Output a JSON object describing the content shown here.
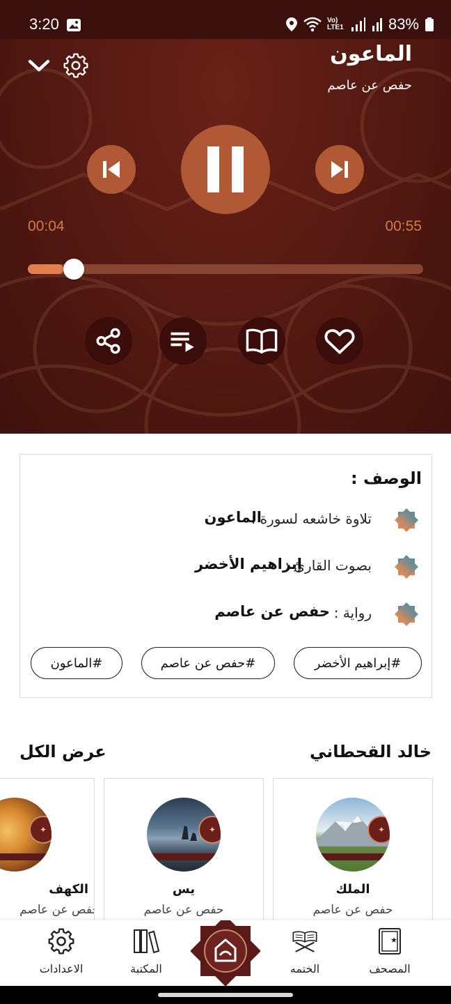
{
  "status": {
    "time": "3:20",
    "battery": "83%",
    "network": "Vo) LTE1"
  },
  "player": {
    "title": "الماعون",
    "subtitle": "حفص عن عاصم",
    "elapsed": "00:04",
    "duration": "00:55",
    "progress": 0.077,
    "is_playing": true,
    "accent_color": "#b15835"
  },
  "description": {
    "heading": "الوصف :",
    "rows": [
      {
        "label": "تلاوة خاشعه لسورة :",
        "value": "الماعون"
      },
      {
        "label": "بصوت القارئ :",
        "value": "إبراهيم الأخضر"
      },
      {
        "label": "رواية :",
        "value": "حفص عن عاصم"
      }
    ],
    "tags": [
      "#إبراهيم الأخضر",
      "#حفص عن عاصم",
      "#الماعون"
    ]
  },
  "related": {
    "title": "خالد القحطاني",
    "see_all": "عرض الكل",
    "items": [
      {
        "title": "الملك",
        "subtitle": "حفص عن عاصم"
      },
      {
        "title": "يس",
        "subtitle": "حفص عن عاصم"
      },
      {
        "title": "الكهف",
        "subtitle": "حفص عن عاصم"
      }
    ]
  },
  "nav": {
    "items": [
      {
        "label": "المصحف",
        "icon": "quran-book-icon"
      },
      {
        "label": "الختمه",
        "icon": "quran-stand-icon"
      },
      {
        "label": "",
        "icon": "app-logo-icon"
      },
      {
        "label": "المكتبة",
        "icon": "library-icon"
      },
      {
        "label": "الاعدادات",
        "icon": "settings-icon"
      }
    ]
  }
}
